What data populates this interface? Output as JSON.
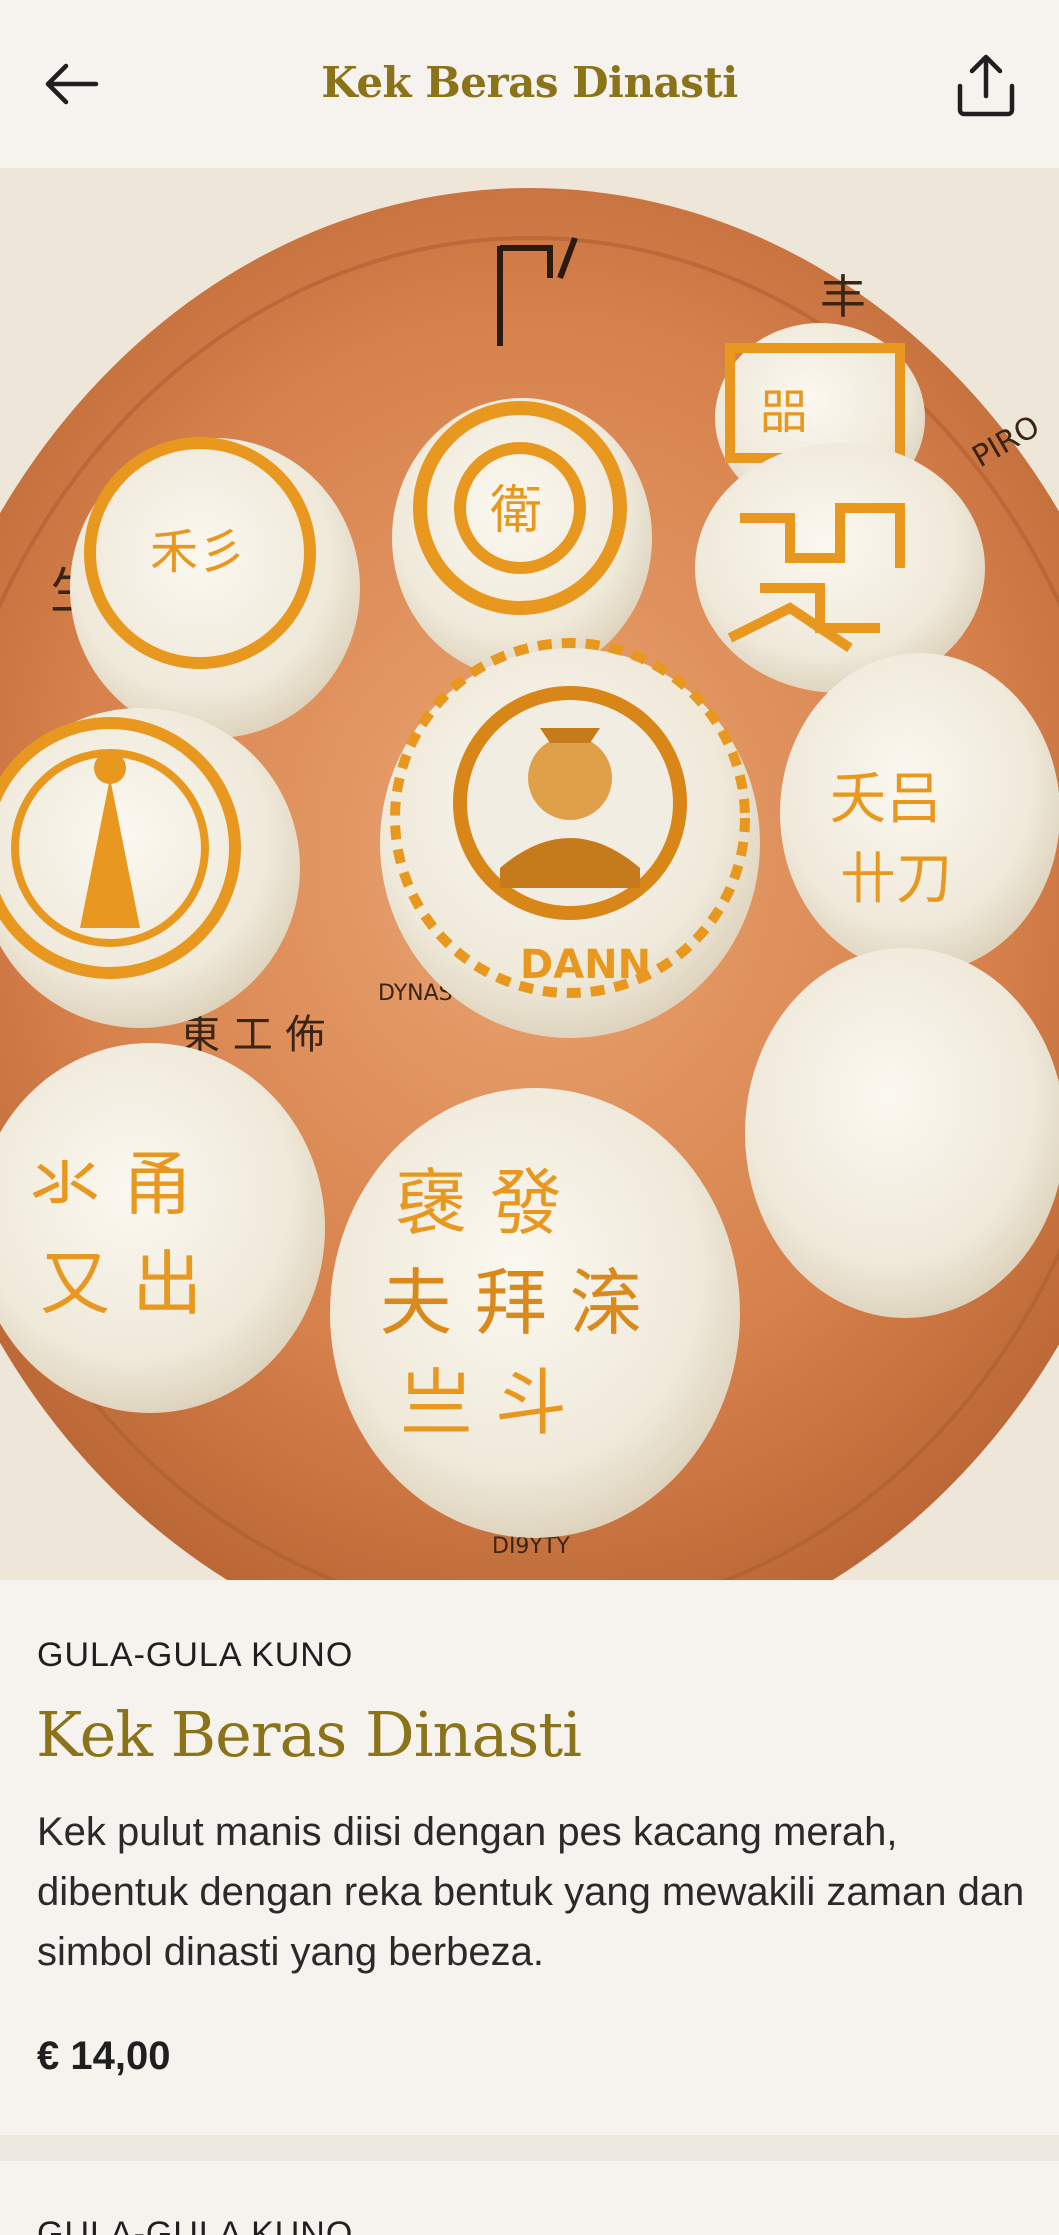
{
  "header": {
    "title": "Kek Beras Dinasti",
    "back_icon": "arrow-left-icon",
    "share_icon": "share-icon"
  },
  "hero": {
    "description": "photo",
    "plate_text": {
      "dynasty_top": "DYNASTY",
      "dynasty_bottom": "DI9YTY",
      "cake_label": "DANN"
    }
  },
  "product": {
    "category": "GULA-GULA KUNO",
    "title": "Kek Beras Dinasti",
    "description": "Kek pulut manis diisi dengan pes kacang merah, dibentuk dengan reka bentuk yang mewakili zaman dan simbol dinasti yang berbeza.",
    "price": "€ 14,00"
  },
  "next_item": {
    "category": "GULA-GULA KUNO"
  },
  "colors": {
    "accent": "#8a7319",
    "background": "#f6f3ee",
    "text": "#1f1f1f",
    "plate": "#d9844f",
    "design_orange": "#e8981f"
  }
}
